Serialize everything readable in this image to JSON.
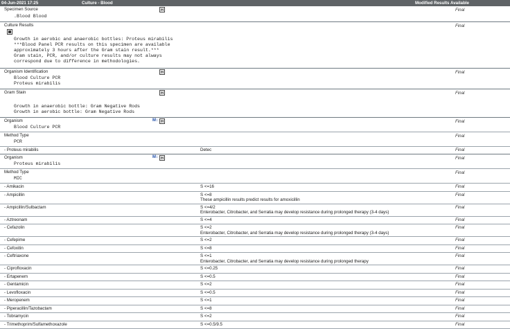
{
  "header": {
    "datetime": "04-Jun-2021 17:25",
    "title": "Culture - Blood",
    "status": "Modified Results Available"
  },
  "sections": {
    "specimen": {
      "label": "Specimen Source",
      "status": "Final",
      "value": ".Blood Blood"
    },
    "culture": {
      "label": "Culture Results",
      "status": "Final",
      "lines": [
        "Growth in aerobic and anaerobic bottles: Proteus mirabilis",
        "***Blood Panel PCR results on this specimen are available",
        "approximately 3 hours after the Gram stain result.***",
        "Gram stain, PCR, and/or culture results may not always",
        "correspond due to difference in methodologies."
      ]
    },
    "orgid": {
      "label": "Organism Identification",
      "status": "Final",
      "lines": [
        "Blood Culture PCR",
        "Proteus mirabilis"
      ]
    },
    "gram": {
      "label": "Gram Stain",
      "status": "Final",
      "lines": [
        "Growth in anaerobic bottle: Gram Negative Rods",
        "Growth in aerobic bottle: Gram Negative Rods"
      ]
    },
    "org1": {
      "label": "Organism",
      "status": "Final",
      "value": "Blood Culture PCR",
      "method_label": "Method Type",
      "method_status": "Final",
      "method_value": "PCR",
      "detect": {
        "name": "- Proteus mirabilis",
        "result": "Detec",
        "status": "Final"
      }
    },
    "org2": {
      "label": "Organism",
      "status": "Final",
      "value": "Proteus mirabilis",
      "method_label": "Method Type",
      "method_status": "Final",
      "method_value": "MIC"
    }
  },
  "icons": {
    "h_icon": "H",
    "micro": "M↕"
  },
  "antibiotics": [
    {
      "name": "- Amikacin",
      "result": "S <=16",
      "status": "Final"
    },
    {
      "name": "- Ampicillin",
      "result": "S <=8",
      "status": "Final",
      "note": "These ampicillin results predict results for amoxicillin"
    },
    {
      "name": "- Ampicillin/Sulbactam",
      "result": "S <=4/2",
      "status": "Final",
      "note": "Enterobacter, Citrobacter, and Serratia may develop resistance during prolonged therapy (3-4 days)"
    },
    {
      "name": "- Aztreonam",
      "result": "S <=4",
      "status": "Final"
    },
    {
      "name": "- Cefazolin",
      "result": "S <=2",
      "status": "Final",
      "note": "Enterobacter, Citrobacter, and Serratia may develop resistance during prolonged therapy (3-4 days)"
    },
    {
      "name": "- Cefepime",
      "result": "S <=2",
      "status": "Final"
    },
    {
      "name": "- Cefoxitin",
      "result": "S <=8",
      "status": "Final"
    },
    {
      "name": "- Ceftriaxone",
      "result": "S <=1",
      "status": "Final",
      "note": "Enterobacter, Citrobacter, and Serratia may develop resistance during prolonged therapy"
    },
    {
      "name": "- Ciprofloxacin",
      "result": "S <=0.25",
      "status": "Final"
    },
    {
      "name": "- Ertapenem",
      "result": "S <=0.5",
      "status": "Final"
    },
    {
      "name": "- Gentamicin",
      "result": "S <=2",
      "status": "Final"
    },
    {
      "name": "- Levofloxacin",
      "result": "S <=0.5",
      "status": "Final"
    },
    {
      "name": "- Meropenem",
      "result": "S <=1",
      "status": "Final"
    },
    {
      "name": "- Piperacillin/Tazobactam",
      "result": "S <=8",
      "status": "Final"
    },
    {
      "name": "- Tobramycin",
      "result": "S <=2",
      "status": "Final"
    },
    {
      "name": "- Trimethoprim/Sulfamethoxazole",
      "result": "S <=0.5/9.5",
      "status": "Final"
    }
  ]
}
